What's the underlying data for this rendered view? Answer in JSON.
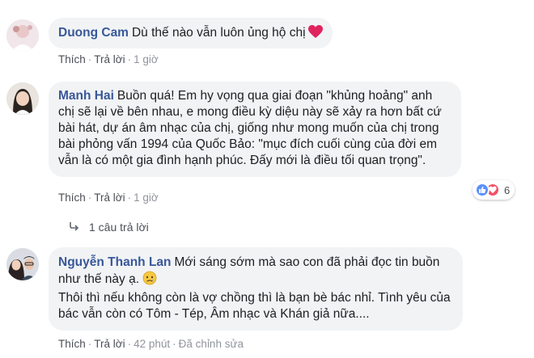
{
  "comments": [
    {
      "author": "Duong Cam",
      "text": "Dù thế nào vẫn luôn ủng hộ chị",
      "emoji": "heart-emoji",
      "actions": {
        "like": "Thích",
        "reply": "Trả lời",
        "time": "1 giờ"
      }
    },
    {
      "author": "Manh Hai",
      "text": "Buồn quá! Em hy vọng qua giai đoạn \"khủng hoảng\" anh chị sẽ lại về bên nhau, e mong điều kỳ diệu này sẽ xảy ra hơn bất cứ bài hát, dự án âm nhạc của chị, giống như mong muốn của chị trong bài phỏng vấn 1994 của Quốc Bảo: \"mục đích cuối cùng của đời em vẫn là có một gia đình hạnh phúc. Đấy mới là điều tối quan trọng\".",
      "actions": {
        "like": "Thích",
        "reply": "Trả lời",
        "time": "1 giờ"
      },
      "reactions": {
        "icons": [
          "like",
          "love"
        ],
        "count": "6"
      },
      "replies_label": "1 câu trả lời"
    },
    {
      "author": "Nguyễn Thanh Lan",
      "text_line1": "Mới sáng sớm mà sao con đã phải đọc tin buồn như thế này ạ.",
      "text_line2": "Thôi thì nếu không còn là vợ chồng thì là bạn bè bác nhỉ. Tình yêu của bác vẫn còn có Tôm - Tép, Âm nhạc và Khán giả nữa....",
      "emoji": "sad-face-emoji",
      "actions": {
        "like": "Thích",
        "reply": "Trả lời",
        "time": "42 phút",
        "edited": "Đã chỉnh sửa"
      }
    }
  ],
  "colors": {
    "author": "#385898",
    "bubble": "#f2f3f5",
    "meta": "#90949c",
    "like": "#5890ff",
    "love": "#f25268"
  }
}
